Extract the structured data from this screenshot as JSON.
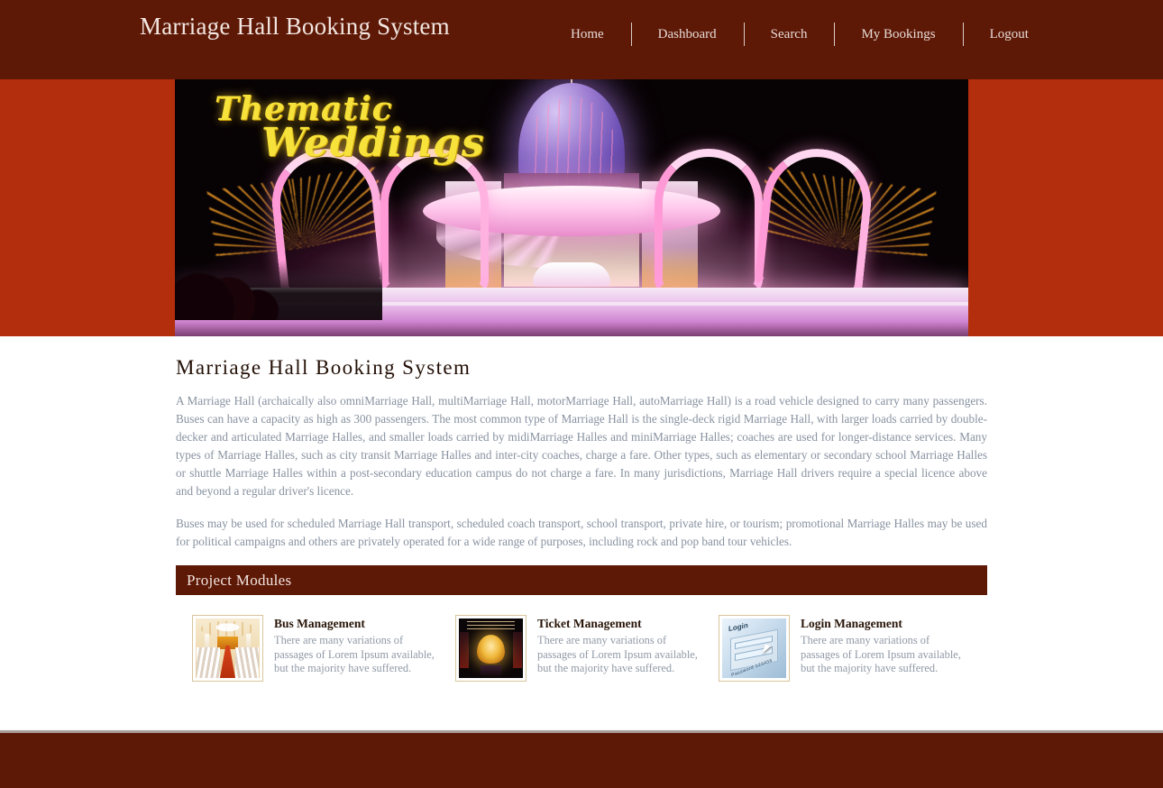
{
  "theme": {
    "header_bg": "#5e1806",
    "hero_band_bg": "#b32e0c",
    "section_bar_bg": "#5e1806",
    "footer_bg": "#5e1806",
    "body_text": "#8892a0",
    "title_text": "#231006",
    "hero_script_color": "#f6e23a"
  },
  "header": {
    "brand": "Marriage Hall Booking System",
    "nav": [
      {
        "label": "Home",
        "name": "nav-home"
      },
      {
        "label": "Dashboard",
        "name": "nav-dashboard"
      },
      {
        "label": "Search",
        "name": "nav-search"
      },
      {
        "label": "My Bookings",
        "name": "nav-my-bookings"
      },
      {
        "label": "Logout",
        "name": "nav-logout"
      }
    ]
  },
  "hero": {
    "image_alt": "illuminated thematic wedding stage with dome and floral arches",
    "script_line1": "Thematic",
    "script_line2": "Weddings"
  },
  "main": {
    "page_title": "Marriage Hall Booking System",
    "paragraph_1": "A Marriage Hall (archaically also omniMarriage Hall, multiMarriage Hall, motorMarriage Hall, autoMarriage Hall) is a road vehicle designed to carry many passengers. Buses can have a capacity as high as 300 passengers. The most common type of Marriage Hall is the single-deck rigid Marriage Hall, with larger loads carried by double-decker and articulated Marriage Halles, and smaller loads carried by midiMarriage Halles and miniMarriage Halles; coaches are used for longer-distance services. Many types of Marriage Halles, such as city transit Marriage Halles and inter-city coaches, charge a fare. Other types, such as elementary or secondary school Marriage Halles or shuttle Marriage Halles within a post-secondary education campus do not charge a fare. In many jurisdictions, Marriage Hall drivers require a special licence above and beyond a regular driver's licence.",
    "paragraph_2": "Buses may be used for scheduled Marriage Hall transport, scheduled coach transport, school transport, private hire, or tourism; promotional Marriage Halles may be used for political campaigns and others are privately operated for a wide range of purposes, including rock and pop band tour vehicles.",
    "section_bar_title": "Project Modules",
    "modules": [
      {
        "title": "Bus Management",
        "description": "There are many variations of passages of Lorem Ipsum available, but the majority have suffered.",
        "thumb": "marriage-hall-interior-thumbnail"
      },
      {
        "title": "Ticket Management",
        "description": "There are many variations of passages of Lorem Ipsum available, but the majority have suffered.",
        "thumb": "venue-entrance-thumbnail"
      },
      {
        "title": "Login Management",
        "description": "There are many variations of passages of Lorem Ipsum available, but the majority have suffered.",
        "thumb": "login-form-thumbnail",
        "thumb_labels": {
          "heading": "Login",
          "submit": "Password 123456"
        }
      }
    ]
  },
  "footer": {
    "text": ""
  }
}
